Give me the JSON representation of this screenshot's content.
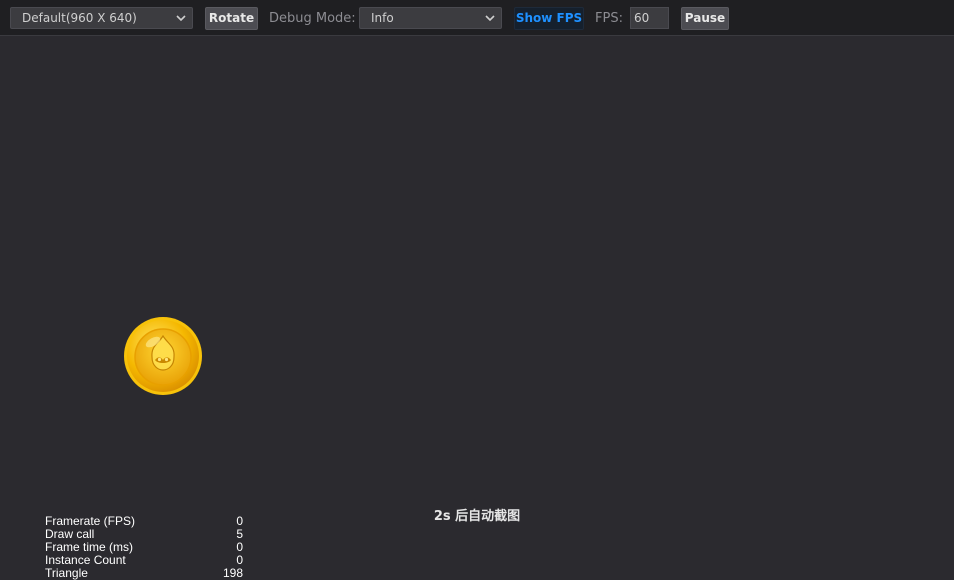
{
  "toolbar": {
    "resolution": {
      "value": "Default(960 X 640)",
      "icon": "chevron-down-icon"
    },
    "rotate_label": "Rotate",
    "debug_label": "Debug Mode:",
    "debug_mode": {
      "value": "Info",
      "icon": "chevron-down-icon"
    },
    "show_fps_label": "Show FPS",
    "fps_label": "FPS:",
    "fps_value": "60",
    "pause_label": "Pause"
  },
  "stage": {
    "auto_screenshot_text": "2s 后自动截图",
    "coin": {
      "icon": "coin-icon",
      "color": "#f5b800"
    }
  },
  "stats": [
    {
      "label": "Framerate (FPS)",
      "value": "0"
    },
    {
      "label": "Draw call",
      "value": "5"
    },
    {
      "label": "Frame time (ms)",
      "value": "0"
    },
    {
      "label": "Instance Count",
      "value": "0"
    },
    {
      "label": "Triangle",
      "value": "198"
    }
  ],
  "colors": {
    "toolbar_bg": "#1f1f22",
    "stage_bg": "#2b2a2f",
    "active_accent": "#1e90ff"
  }
}
